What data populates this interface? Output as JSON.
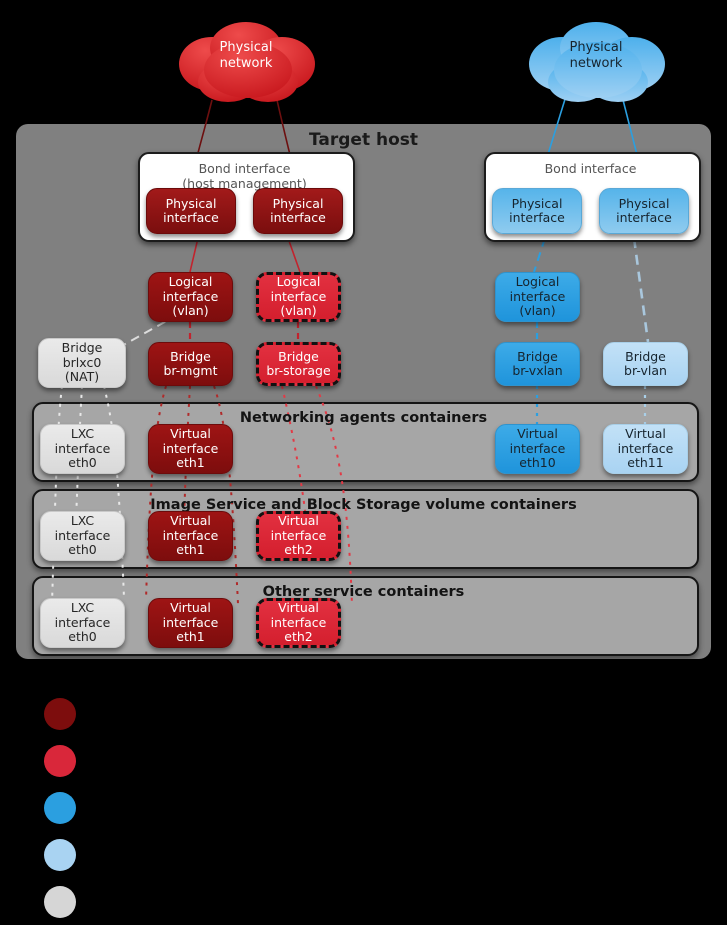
{
  "host": {
    "title": "Target host"
  },
  "clouds": [
    {
      "name": "cloud-physical-network-red",
      "label": "Physical\nnetwork",
      "color": "#d92027",
      "text_color": "#ffffff"
    },
    {
      "name": "cloud-physical-network-blue",
      "label": "Physical\nnetwork",
      "color": "#3aa7e8",
      "text_color": "#17242e"
    }
  ],
  "bonds": [
    {
      "name": "bond-interface-host-management",
      "label": "Bond interface\n(host management)",
      "interfaces": [
        {
          "label": "Physical\ninterface",
          "style": "physred"
        },
        {
          "label": "Physical\ninterface",
          "style": "physred"
        }
      ]
    },
    {
      "name": "bond-interface-right",
      "label": "Bond interface",
      "interfaces": [
        {
          "label": "Physical\ninterface",
          "style": "physblue"
        },
        {
          "label": "Physical\ninterface",
          "style": "physblue"
        }
      ]
    }
  ],
  "logical_interfaces": [
    {
      "name": "logical-interface-vlan-mgmt",
      "label": "Logical\ninterface\n(vlan)",
      "style": "darkred"
    },
    {
      "name": "logical-interface-vlan-storage",
      "label": "Logical\ninterface\n(vlan)",
      "style": "brightred"
    },
    {
      "name": "logical-interface-vlan-vxlan",
      "label": "Logical\ninterface\n(vlan)",
      "style": "medblue"
    }
  ],
  "bridges": [
    {
      "name": "bridge-brlxc0",
      "label": "Bridge\nbrlxc0\n(NAT)",
      "style": "gray"
    },
    {
      "name": "bridge-br-mgmt",
      "label": "Bridge\nbr-mgmt",
      "style": "darkred"
    },
    {
      "name": "bridge-br-storage",
      "label": "Bridge\nbr-storage",
      "style": "brightred"
    },
    {
      "name": "bridge-br-vxlan",
      "label": "Bridge\nbr-vxlan",
      "style": "medblue"
    },
    {
      "name": "bridge-br-vlan",
      "label": "Bridge\nbr-vlan",
      "style": "lightblue"
    }
  ],
  "bands": [
    {
      "name": "band-networking-agents",
      "title": "Networking agents containers",
      "nodes": [
        {
          "label": "LXC\ninterface\neth0",
          "style": "gray"
        },
        {
          "label": "Virtual\ninterface\neth1",
          "style": "darkred"
        },
        {
          "label": "Virtual\ninterface\neth10",
          "style": "medblue"
        },
        {
          "label": "Virtual\ninterface\neth11",
          "style": "lightblue"
        }
      ]
    },
    {
      "name": "band-image-service-block-storage",
      "title": "Image Service and Block Storage volume containers",
      "nodes": [
        {
          "label": "LXC\ninterface\neth0",
          "style": "gray"
        },
        {
          "label": "Virtual\ninterface\neth1",
          "style": "darkred"
        },
        {
          "label": "Virtual\ninterface\neth2",
          "style": "brightred"
        }
      ]
    },
    {
      "name": "band-other-service",
      "title": "Other service containers",
      "nodes": [
        {
          "label": "LXC\ninterface\neth0",
          "style": "gray"
        },
        {
          "label": "Virtual\ninterface\neth1",
          "style": "darkred"
        },
        {
          "label": "Virtual\ninterface\neth2",
          "style": "brightred"
        }
      ]
    }
  ],
  "legend": [
    {
      "name": "legend-dot-dark-red",
      "color": "#7d0d0d",
      "label": ""
    },
    {
      "name": "legend-dot-bright-red",
      "color": "#d9273a",
      "label": ""
    },
    {
      "name": "legend-dot-medium-blue",
      "color": "#2b9fe0",
      "label": ""
    },
    {
      "name": "legend-dot-light-blue",
      "color": "#a9d3f2",
      "label": ""
    },
    {
      "name": "legend-dot-gray",
      "color": "#d6d6d6",
      "label": ""
    }
  ],
  "colors": {
    "dark_red": "#7d0d0d",
    "bright_red": "#d9273a",
    "medium_blue": "#2b9fe0",
    "light_blue": "#a9d3f2",
    "gray": "#d6d6d6",
    "host_panel": "#808080",
    "band": "#a6a6a6",
    "background": "#000000"
  }
}
